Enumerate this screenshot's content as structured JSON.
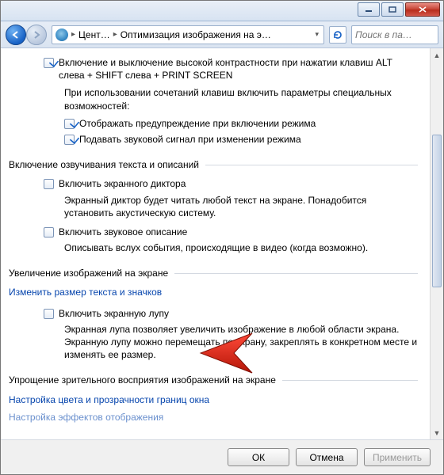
{
  "window": {
    "breadcrumb1": "Цент…",
    "breadcrumb2": "Оптимизация изображения на э…",
    "search_placeholder": "Поиск в па…"
  },
  "section_contrast": {
    "cb_main": "Включение и выключение высокой контрастности при нажатии клавиш ALT слева + SHIFT слева + PRINT SCREEN",
    "note": "При использовании сочетаний клавиш включить параметры специальных возможностей:",
    "cb_warn": "Отображать предупреждение при включении режима",
    "cb_sound": "Подавать звуковой сигнал при изменении режима"
  },
  "section_speech": {
    "title": "Включение озвучивания текста и описаний",
    "cb_narrator": "Включить экранного диктора",
    "narrator_desc": "Экранный диктор будет читать любой текст на экране. Понадобится установить акустическую систему.",
    "cb_audio_desc": "Включить звуковое описание",
    "audio_desc_desc": "Описывать вслух события, происходящие в видео (когда возможно)."
  },
  "section_magnify": {
    "title": "Увеличение изображений на экране",
    "link_resize": "Изменить размер текста и значков",
    "cb_magnifier": "Включить экранную лупу",
    "magnifier_desc": "Экранная лупа позволяет увеличить изображение в любой области экрана. Экранную лупу можно перемещать по экрану, закреплять в конкретном месте и изменять ее размер."
  },
  "section_simplify": {
    "title": "Упрощение зрительного восприятия изображений на экране",
    "link_color": "Настройка цвета и прозрачности границ окна",
    "link_effects": "Настройка эффектов отображения"
  },
  "buttons": {
    "ok": "ОК",
    "cancel": "Отмена",
    "apply": "Применить"
  }
}
